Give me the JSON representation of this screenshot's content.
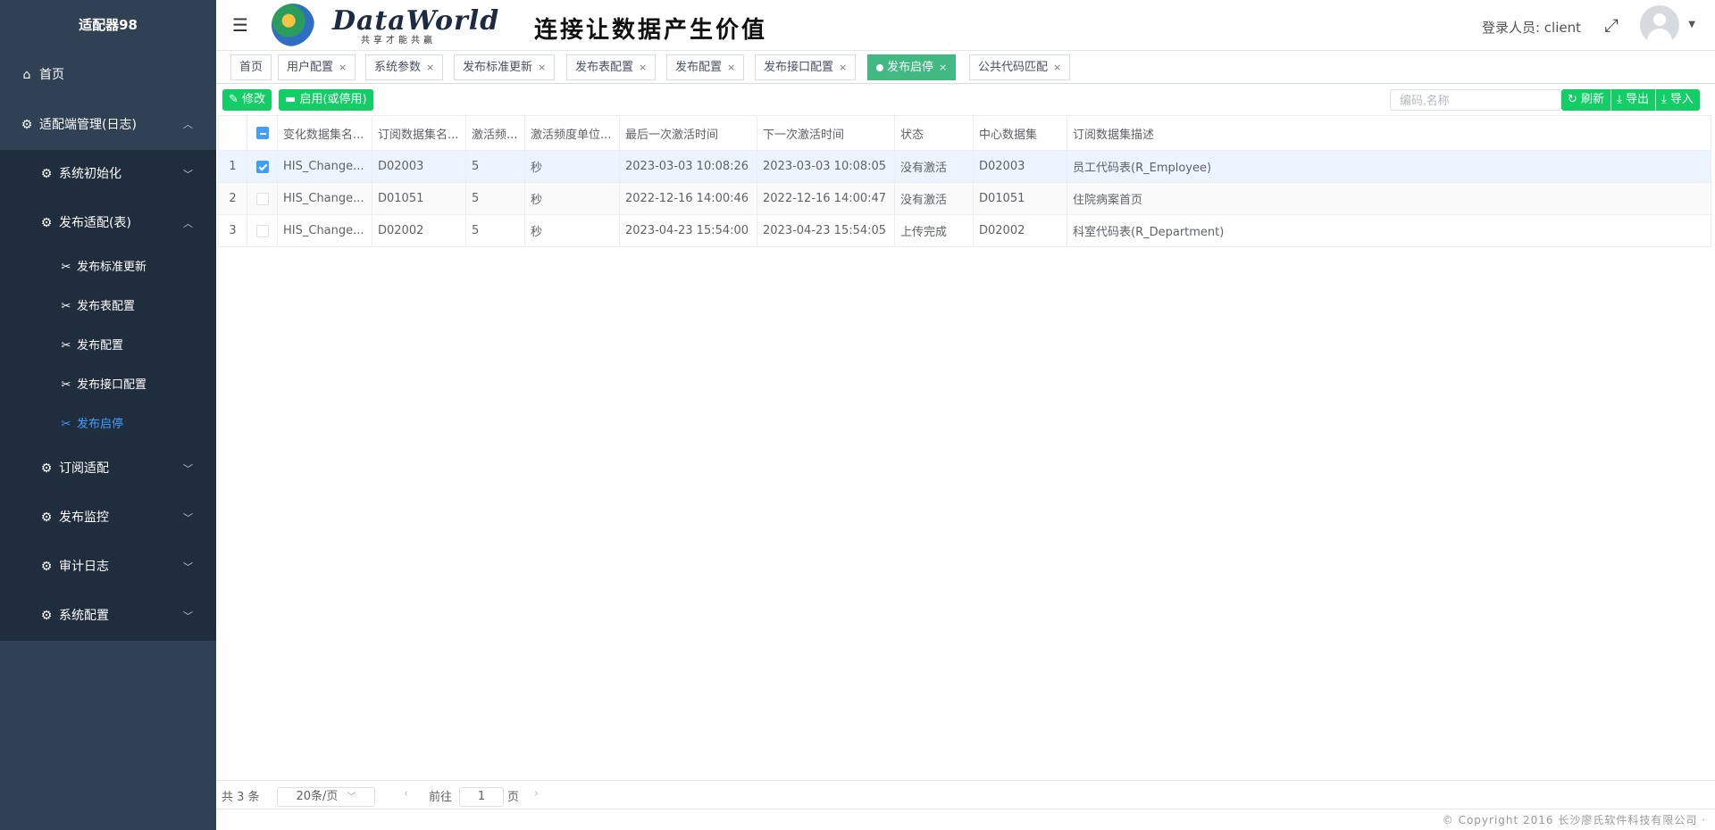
{
  "sidebar": {
    "brand": "适配器98",
    "home": "首页",
    "group_main": "适配端管理(日志)",
    "sub_init": "系统初始化",
    "sub_publish": "发布适配(表)",
    "leaves": [
      "发布标准更新",
      "发布表配置",
      "发布配置",
      "发布接口配置",
      "发布启停"
    ],
    "sub_subscribe": "订阅适配",
    "sub_monitor": "发布监控",
    "sub_audit": "审计日志",
    "sub_sysconfig": "系统配置"
  },
  "header": {
    "logo_text": "DataWorld",
    "logo_sub": "共享才能共赢",
    "slogan": "连接让数据产生价值",
    "login_label": "登录人员:",
    "user": "client"
  },
  "tabs": [
    {
      "label": "首页",
      "closable": false
    },
    {
      "label": "用户配置",
      "closable": true
    },
    {
      "label": "系统参数",
      "closable": true
    },
    {
      "label": "发布标准更新",
      "closable": true
    },
    {
      "label": "发布表配置",
      "closable": true
    },
    {
      "label": "发布配置",
      "closable": true
    },
    {
      "label": "发布接口配置",
      "closable": true
    },
    {
      "label": "发布启停",
      "closable": true,
      "active": true
    },
    {
      "label": "公共代码匹配",
      "closable": true
    }
  ],
  "toolbar": {
    "edit_label": "修改",
    "toggle_label": "启用(或停用)",
    "search_placeholder": "编码,名称",
    "refresh_label": "刷新",
    "export_label": "导出",
    "import_label": "导入"
  },
  "table": {
    "headers": [
      "变化数据集名...",
      "订阅数据集名...",
      "激活频...",
      "激活频度单位...",
      "最后一次激活时间",
      "下一次激活时间",
      "状态",
      "中心数据集",
      "订阅数据集描述"
    ],
    "rows": [
      {
        "index": "1",
        "checked": true,
        "cells": [
          "HIS_Change...",
          "D02003",
          "5",
          "秒",
          "2023-03-03 10:08:26",
          "2023-03-03 10:08:05",
          "没有激活",
          "D02003",
          "员工代码表(R_Employee)"
        ]
      },
      {
        "index": "2",
        "checked": false,
        "cells": [
          "HIS_Change...",
          "D01051",
          "5",
          "秒",
          "2022-12-16 14:00:46",
          "2022-12-16 14:00:47",
          "没有激活",
          "D01051",
          "住院病案首页"
        ]
      },
      {
        "index": "3",
        "checked": false,
        "cells": [
          "HIS_Change...",
          "D02002",
          "5",
          "秒",
          "2023-04-23 15:54:00",
          "2023-04-23 15:54:05",
          "上传完成",
          "D02002",
          "科室代码表(R_Department)"
        ]
      }
    ]
  },
  "pagination": {
    "total": "共 3 条",
    "page_size": "20条/页",
    "goto_label": "前往",
    "page": "1",
    "page_suffix": "页"
  },
  "footer": {
    "copyright": "© Copyright 2016 长沙廖氏软件科技有限公司 ·"
  },
  "colors": {
    "sidebar_bg": "#304156",
    "submenu_bg": "#1f2d3d",
    "accent": "#13ce66",
    "active_tab": "#42b983",
    "active_link": "#409eff"
  }
}
